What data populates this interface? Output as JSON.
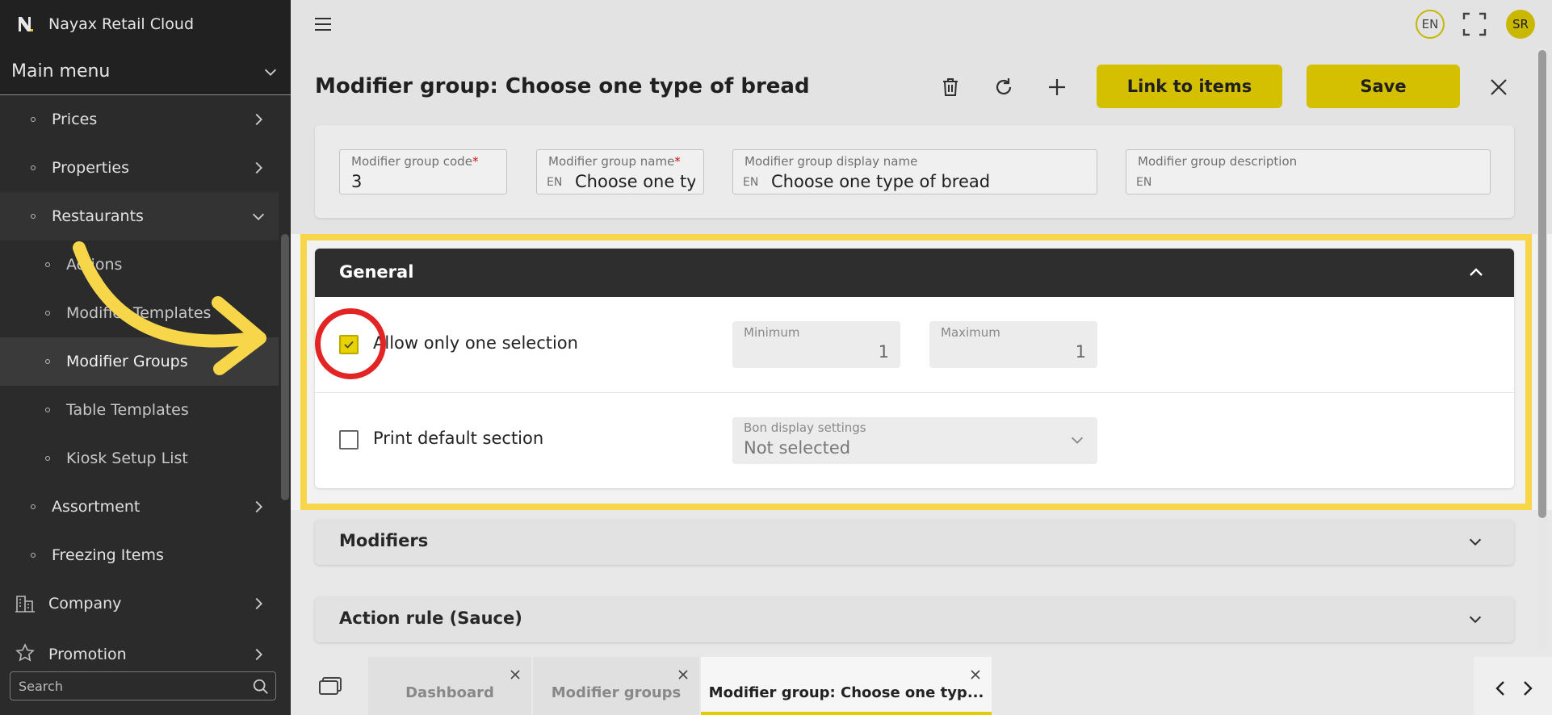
{
  "app": {
    "title": "Nayax Retail Cloud"
  },
  "sidebar": {
    "menu_title": "Main menu",
    "items": [
      {
        "label": "Prices"
      },
      {
        "label": "Properties"
      },
      {
        "label": "Restaurants"
      },
      {
        "label": "Actions"
      },
      {
        "label": "Modifier Templates"
      },
      {
        "label": "Modifier Groups"
      },
      {
        "label": "Table Templates"
      },
      {
        "label": "Kiosk Setup List"
      },
      {
        "label": "Assortment"
      },
      {
        "label": "Freezing Items"
      },
      {
        "label": "Company"
      },
      {
        "label": "Promotion"
      }
    ],
    "search_placeholder": "Search"
  },
  "topbar": {
    "language": "EN",
    "user_initials": "SR"
  },
  "page": {
    "title": "Modifier group: Choose one type of bread",
    "link_button": "Link to items",
    "save_button": "Save"
  },
  "fields": {
    "code": {
      "label": "Modifier group code",
      "value": "3"
    },
    "name": {
      "label": "Modifier group name",
      "lang": "EN",
      "value": "Choose one ty"
    },
    "display_name": {
      "label": "Modifier group display name",
      "lang": "EN",
      "value": "Choose one type of bread"
    },
    "description": {
      "label": "Modifier group description",
      "lang": "EN",
      "value": ""
    },
    "required_mark": "*"
  },
  "general": {
    "title": "General",
    "allow_one": {
      "label": "Allow only one selection",
      "checked": true
    },
    "minimum": {
      "label": "Minimum",
      "value": "1"
    },
    "maximum": {
      "label": "Maximum",
      "value": "1"
    },
    "print_default": {
      "label": "Print default section",
      "checked": false
    },
    "bon_display": {
      "label": "Bon display settings",
      "value": "Not selected"
    }
  },
  "sections": [
    {
      "title": "Modifiers"
    },
    {
      "title": "Action rule (Sauce)"
    }
  ],
  "tabs": [
    {
      "label": "Dashboard"
    },
    {
      "label": "Modifier groups"
    },
    {
      "label": "Modifier group: Choose one typ..."
    }
  ],
  "colors": {
    "accent_yellow": "#e2cc00",
    "highlight_yellow": "#f7d649",
    "annotation_red": "#e32424",
    "sidebar_bg": "#2b2b2b"
  }
}
